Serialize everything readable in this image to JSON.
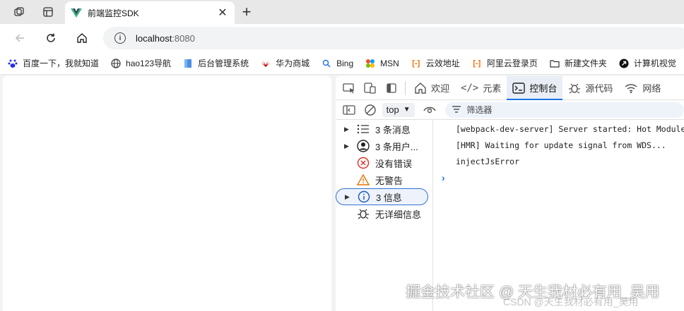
{
  "tab": {
    "title": "前端监控SDK",
    "close_icon": "close-icon"
  },
  "address": {
    "host": "localhost",
    "port": ":8080"
  },
  "bookmarks": [
    {
      "label": "百度一下，我就知道",
      "icon": "baidu-icon"
    },
    {
      "label": "hao123导航",
      "icon": "globe-icon"
    },
    {
      "label": "后台管理系统",
      "icon": "page-icon"
    },
    {
      "label": "华为商城",
      "icon": "huawei-icon"
    },
    {
      "label": "Bing",
      "icon": "search-icon"
    },
    {
      "label": "MSN",
      "icon": "msn-icon"
    },
    {
      "label": "云效地址",
      "icon": "aliyun-icon"
    },
    {
      "label": "阿里云登录页",
      "icon": "aliyun-icon"
    },
    {
      "label": "新建文件夹",
      "icon": "folder-icon"
    },
    {
      "label": "计算机视觉",
      "icon": "arrow-icon"
    }
  ],
  "devtools": {
    "tabs": [
      {
        "label": "欢迎"
      },
      {
        "label": "元素"
      },
      {
        "label": "控制台"
      },
      {
        "label": "源代码"
      },
      {
        "label": "网络"
      }
    ],
    "context": "top",
    "filter_placeholder": "筛选器",
    "sidebar": [
      {
        "label": "3 条消息"
      },
      {
        "label": "3 条用户..."
      },
      {
        "label": "没有错误"
      },
      {
        "label": "无警告"
      },
      {
        "label": "3 信息"
      },
      {
        "label": "无详细信息"
      }
    ],
    "logs": [
      {
        "text": "[webpack-dev-server] Server started: Hot Module Replacement enabled"
      },
      {
        "text": "[HMR] Waiting for update signal from WDS..."
      },
      {
        "text": "injectJsError"
      }
    ]
  },
  "watermark": "掘金技术社区 @ 天生我材必有用_吴用",
  "watermark_csdn": "CSDN @天生我材必有用_吴用"
}
